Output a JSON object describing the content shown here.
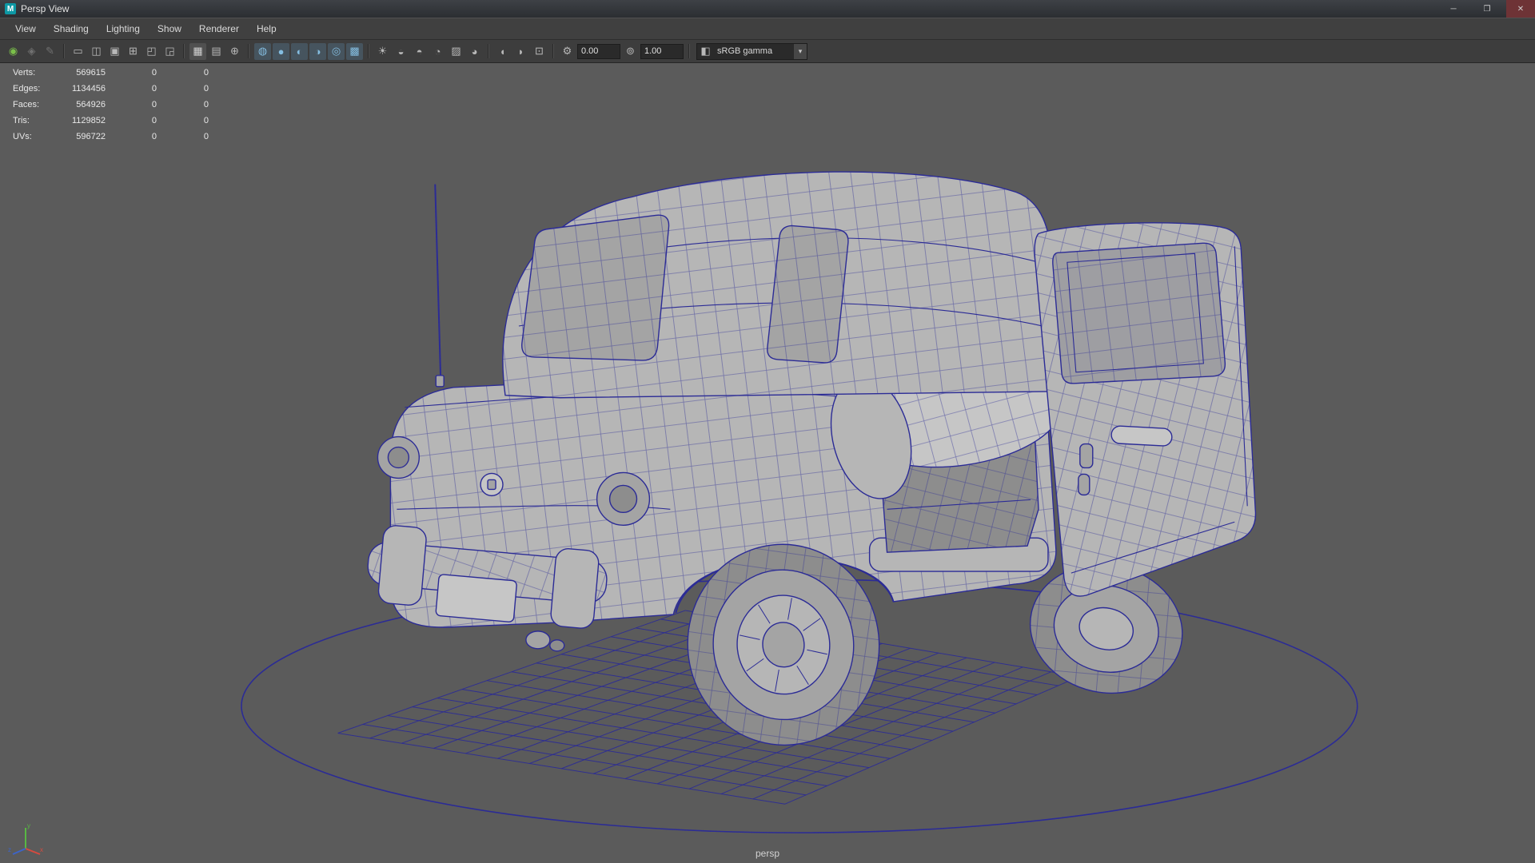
{
  "window": {
    "title": "Persp View",
    "icon_letter": "M",
    "controls": {
      "minimize": "─",
      "maximize": "❐",
      "close": "✕"
    }
  },
  "menu": {
    "items": [
      "View",
      "Shading",
      "Lighting",
      "Show",
      "Renderer",
      "Help"
    ]
  },
  "toolbar": {
    "items": [
      {
        "type": "icon",
        "name": "select-camera-icon",
        "glyph": "◉",
        "tone": "green"
      },
      {
        "type": "icon",
        "name": "lock-camera-icon",
        "glyph": "◈",
        "tone": "dim"
      },
      {
        "type": "icon",
        "name": "camera-attributes-icon",
        "glyph": "✎",
        "tone": "dim"
      },
      {
        "type": "sep"
      },
      {
        "type": "icon",
        "name": "film-gate-icon",
        "glyph": "▭",
        "tone": "normal"
      },
      {
        "type": "icon",
        "name": "resolution-gate-icon",
        "glyph": "◫",
        "tone": "normal"
      },
      {
        "type": "icon",
        "name": "gate-mask-icon",
        "glyph": "▣",
        "tone": "normal"
      },
      {
        "type": "icon",
        "name": "field-chart-icon",
        "glyph": "⊞",
        "tone": "normal"
      },
      {
        "type": "icon",
        "name": "safe-action-icon",
        "glyph": "◰",
        "tone": "normal"
      },
      {
        "type": "icon",
        "name": "safe-title-icon",
        "glyph": "◲",
        "tone": "normal"
      },
      {
        "type": "sep"
      },
      {
        "type": "icon",
        "name": "grid-icon",
        "glyph": "▦",
        "tone": "active"
      },
      {
        "type": "icon",
        "name": "image-plane-icon",
        "glyph": "▤",
        "tone": "normal"
      },
      {
        "type": "icon",
        "name": "2d-pan-zoom-icon",
        "glyph": "⊕",
        "tone": "normal"
      },
      {
        "type": "sep"
      },
      {
        "type": "icon",
        "name": "wireframe-icon",
        "glyph": "◍",
        "tone": "blue"
      },
      {
        "type": "icon",
        "name": "smooth-shade-icon",
        "glyph": "●",
        "tone": "blue"
      },
      {
        "type": "icon",
        "name": "textured-icon",
        "glyph": "◐",
        "tone": "blue"
      },
      {
        "type": "icon",
        "name": "use-default-material-icon",
        "glyph": "◑",
        "tone": "blue"
      },
      {
        "type": "icon",
        "name": "wireframe-on-shaded-icon",
        "glyph": "◎",
        "tone": "blue"
      },
      {
        "type": "icon",
        "name": "checker-material-icon",
        "glyph": "▩",
        "tone": "blue"
      },
      {
        "type": "sep"
      },
      {
        "type": "icon",
        "name": "lighting-icon",
        "glyph": "☀",
        "tone": "normal"
      },
      {
        "type": "icon",
        "name": "shadows-icon",
        "glyph": "◒",
        "tone": "normal"
      },
      {
        "type": "icon",
        "name": "ambient-occlusion-icon",
        "glyph": "◓",
        "tone": "normal"
      },
      {
        "type": "icon",
        "name": "motion-blur-icon",
        "glyph": "◔",
        "tone": "normal"
      },
      {
        "type": "icon",
        "name": "multisampling-icon",
        "glyph": "▨",
        "tone": "normal"
      },
      {
        "type": "icon",
        "name": "depth-of-field-icon",
        "glyph": "◕",
        "tone": "normal"
      },
      {
        "type": "sep"
      },
      {
        "type": "icon",
        "name": "isolate-select-icon",
        "glyph": "◖",
        "tone": "normal"
      },
      {
        "type": "icon",
        "name": "xray-icon",
        "glyph": "◗",
        "tone": "normal"
      },
      {
        "type": "icon",
        "name": "snapshot-icon",
        "glyph": "⊡",
        "tone": "normal"
      },
      {
        "type": "sep"
      },
      {
        "type": "field",
        "name": "exposure-field",
        "icon_name": "exposure-icon",
        "icon": "⚙",
        "value": "0.00"
      },
      {
        "type": "field",
        "name": "gamma-field",
        "icon_name": "gamma-icon",
        "icon": "⊚",
        "value": "1.00"
      },
      {
        "type": "sep"
      },
      {
        "type": "dropdown",
        "name": "view-transform-dropdown",
        "icon_name": "color-management-icon",
        "icon": "◧",
        "label": "sRGB gamma"
      }
    ]
  },
  "hud": {
    "rows": [
      {
        "label": "Verts:",
        "value": "569615",
        "c1": "0",
        "c2": "0"
      },
      {
        "label": "Edges:",
        "value": "1134456",
        "c1": "0",
        "c2": "0"
      },
      {
        "label": "Faces:",
        "value": "564926",
        "c1": "0",
        "c2": "0"
      },
      {
        "label": "Tris:",
        "value": "1129852",
        "c1": "0",
        "c2": "0"
      },
      {
        "label": "UVs:",
        "value": "596722",
        "c1": "0",
        "c2": "0"
      }
    ]
  },
  "viewport": {
    "camera_label": "persp",
    "model": "cartoon-car-wireframe-with-open-door",
    "colors": {
      "background": "#5b5b5b",
      "wireframe": "#2b2b96",
      "body": "#b6b6b6",
      "axis_x": "#d84a3f",
      "axis_y": "#58b843",
      "axis_z": "#3d64c8"
    }
  },
  "axis": {
    "labels": {
      "x": "x",
      "y": "y",
      "z": "z"
    }
  }
}
